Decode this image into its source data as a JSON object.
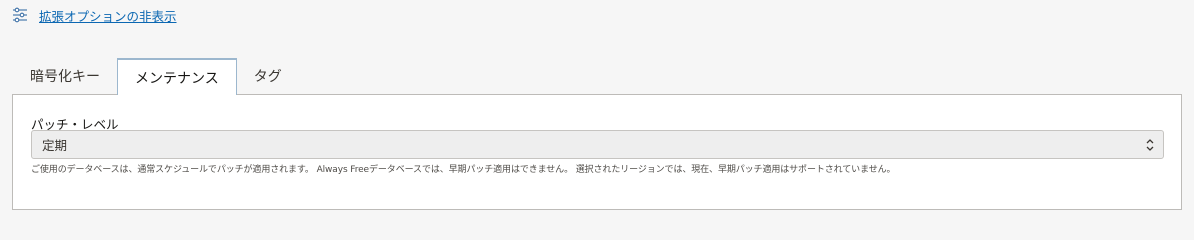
{
  "advanced": {
    "icon": "sliders-icon",
    "link_label": "拡張オプションの非表示"
  },
  "tabs": [
    {
      "label": "暗号化キー",
      "active": false
    },
    {
      "label": "メンテナンス",
      "active": true
    },
    {
      "label": "タグ",
      "active": false
    }
  ],
  "maintenance": {
    "patch_level_label": "パッチ・レベル",
    "patch_level_value": "定期",
    "help_text": "ご使用のデータベースは、通常スケジュールでパッチが適用されます。 Always Freeデータベースでは、早期パッチ適用はできません。 選択されたリージョンでは、現在、早期パッチ適用はサポートされていません。"
  },
  "colors": {
    "link": "#0b67b2",
    "tab_border": "#9cb7ce",
    "panel_border": "#bdbbb8",
    "select_bg": "#eeeeee"
  }
}
